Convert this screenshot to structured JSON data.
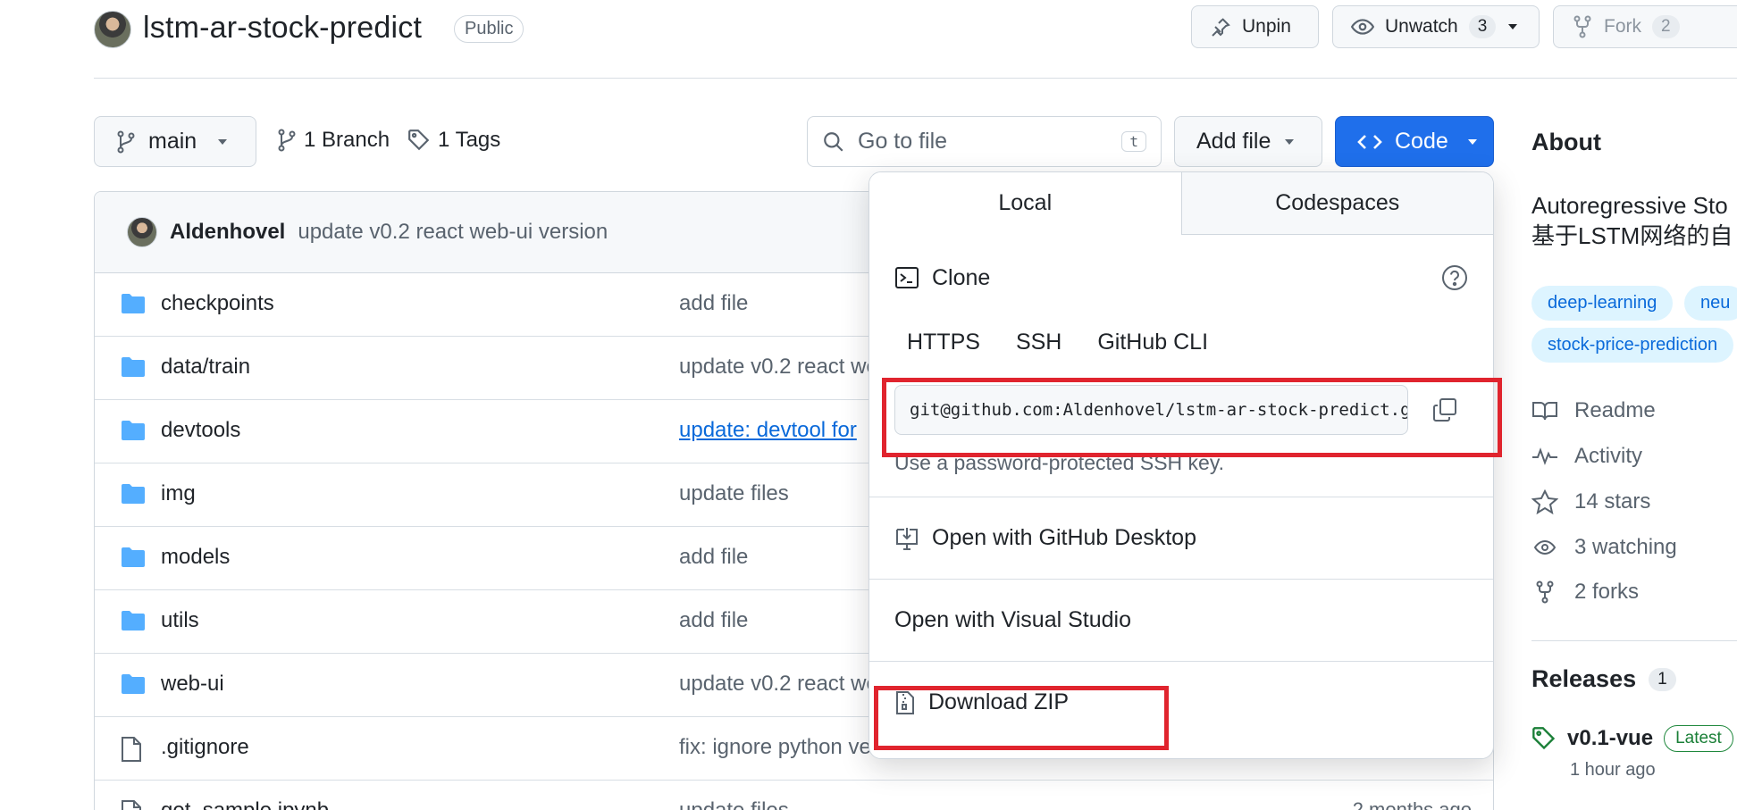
{
  "repo": {
    "name": "lstm-ar-stock-predict",
    "visibility": "Public"
  },
  "header_actions": {
    "unpin_label": "Unpin",
    "unwatch_label": "Unwatch",
    "watch_count": "3",
    "fork_label": "Fork",
    "fork_count": "2"
  },
  "toolbar": {
    "branch": "main",
    "branches": "1 Branch",
    "tags": "1 Tags",
    "search_placeholder": "Go to file",
    "search_shortcut": "t",
    "add_file": "Add file",
    "code": "Code"
  },
  "latest_commit": {
    "author": "Aldenhovel",
    "message": "update v0.2 react web-ui version"
  },
  "files": [
    {
      "name": "checkpoints",
      "type": "folder",
      "commit": "add file",
      "age": ""
    },
    {
      "name": "data/train",
      "type": "folder",
      "commit": "update v0.2 react we",
      "age": ""
    },
    {
      "name": "devtools",
      "type": "folder",
      "commit": "update: devtool for",
      "age": ""
    },
    {
      "name": "img",
      "type": "folder",
      "commit": "update files",
      "age": ""
    },
    {
      "name": "models",
      "type": "folder",
      "commit": "add file",
      "age": ""
    },
    {
      "name": "utils",
      "type": "folder",
      "commit": "add file",
      "age": ""
    },
    {
      "name": "web-ui",
      "type": "folder",
      "commit": "update v0.2 react we",
      "age": ""
    },
    {
      "name": ".gitignore",
      "type": "file",
      "commit": "fix: ignore python ve",
      "age": ""
    },
    {
      "name": "get_sample.ipynb",
      "type": "file",
      "commit": "update files",
      "age": "2 months ago"
    }
  ],
  "code_popover": {
    "tabs": [
      "Local",
      "Codespaces"
    ],
    "clone_label": "Clone",
    "protocols": [
      "HTTPS",
      "SSH",
      "GitHub CLI"
    ],
    "clone_url": "git@github.com:Aldenhovel/lstm-ar-stock-predict.git",
    "hint": "Use a password-protected SSH key.",
    "open_desktop": "Open with GitHub Desktop",
    "open_vs": "Open with Visual Studio",
    "download_zip": "Download ZIP"
  },
  "about": {
    "title": "About",
    "desc_line1": "Autoregressive Sto",
    "desc_line2": "基于LSTM网络的自",
    "topics": [
      "deep-learning",
      "neu",
      "stock-price-prediction"
    ],
    "readme": "Readme",
    "activity": "Activity",
    "stars": "14 stars",
    "watching": "3 watching",
    "forks": "2 forks",
    "releases_title": "Releases",
    "releases_count": "1",
    "release_tag": "v0.1-vue",
    "latest_badge": "Latest",
    "release_time": "1 hour ago"
  },
  "colors": {
    "primary_button": "#1f6feb",
    "folder_icon": "#54aeff",
    "highlight_box": "#e0242e"
  }
}
